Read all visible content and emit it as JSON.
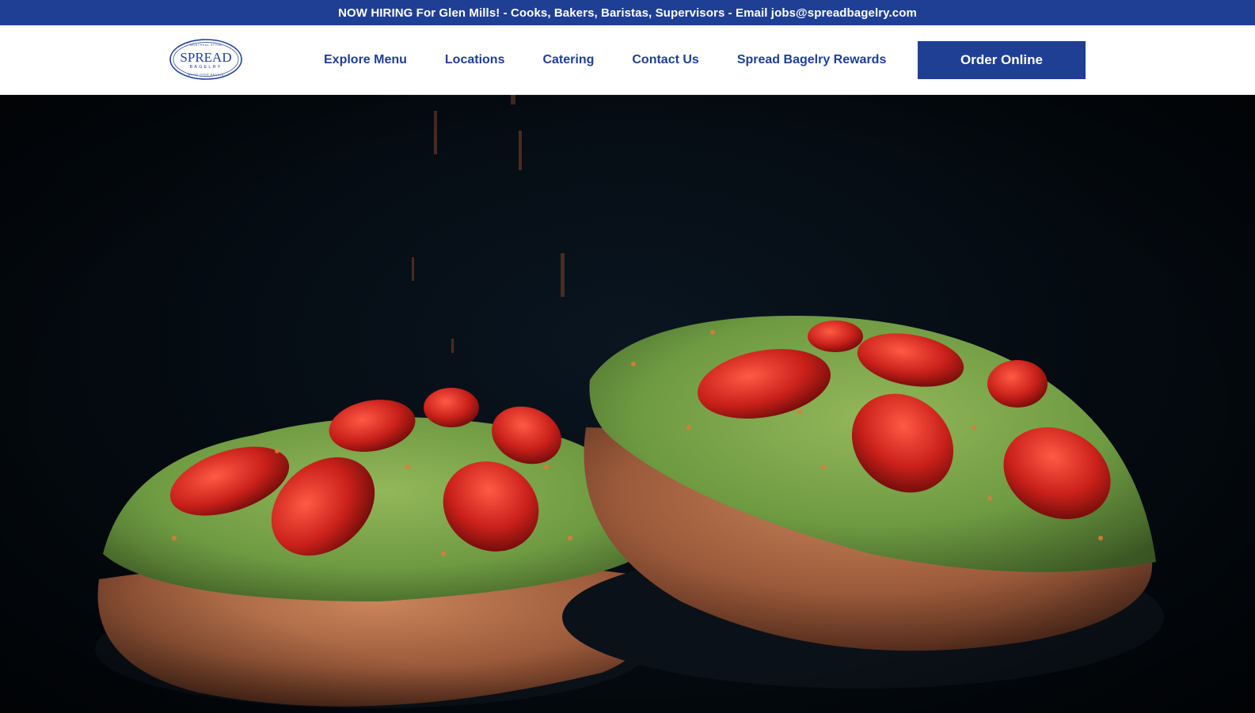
{
  "announcement": "NOW HIRING For Glen Mills! - Cooks, Bakers, Baristas, Supervisors - Email jobs@spreadbagelry.com",
  "logo": {
    "arc_top": "MONTREAL STYLE",
    "wordmark": "SPREAD",
    "sub": "BAGELRY",
    "arc_bottom": "WOOD OVEN BAGELS"
  },
  "nav": {
    "items": [
      {
        "label": "Explore Menu"
      },
      {
        "label": "Locations"
      },
      {
        "label": "Catering"
      },
      {
        "label": "Contact Us"
      },
      {
        "label": "Spread Bagelry Rewards"
      }
    ],
    "cta": "Order Online"
  },
  "colors": {
    "brand_blue": "#1f3f95",
    "hero_bg": "#040a10"
  },
  "hero": {
    "image": "avocado-toast-bagels-photo"
  }
}
